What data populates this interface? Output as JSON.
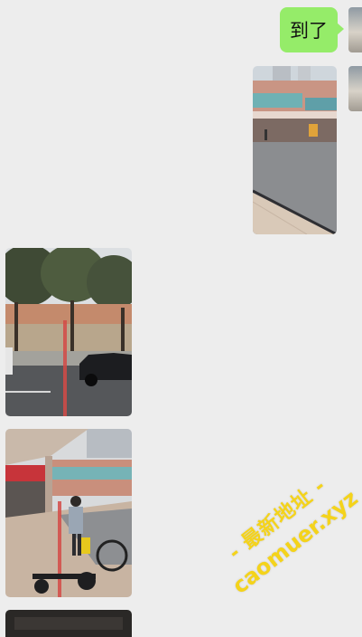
{
  "messages": [
    {
      "kind": "text",
      "side": "right",
      "text": "到了"
    },
    {
      "kind": "image",
      "side": "right",
      "scene": "plaza-building"
    },
    {
      "kind": "image",
      "side": "left",
      "scene": "street-trees-car"
    },
    {
      "kind": "image",
      "side": "left",
      "scene": "arcade-walkway-person"
    },
    {
      "kind": "image",
      "side": "left",
      "scene": "partial-photo"
    }
  ],
  "watermark": {
    "line1": "- 最新地址 -",
    "line2": "caomuer.xyz",
    "color": "#f4d31b"
  },
  "colors": {
    "background": "#ededed",
    "outgoing_bubble": "#95ec69"
  }
}
